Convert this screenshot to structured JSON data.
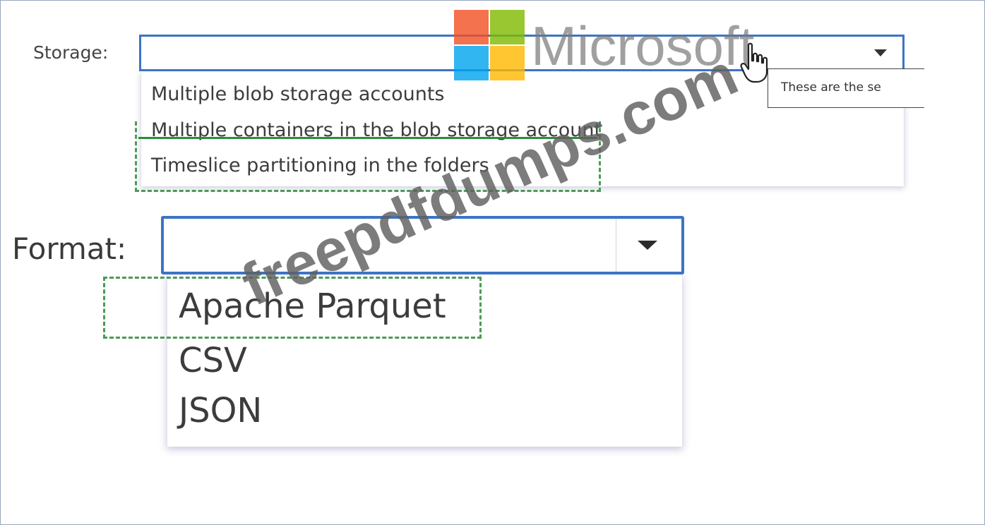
{
  "storage": {
    "label": "Storage:",
    "selected_value": "",
    "options": [
      "Multiple blob storage accounts",
      "Multiple containers in the blob storage account",
      "Timeslice partitioning in the folders"
    ],
    "tooltip": "These are the se"
  },
  "format": {
    "label": "Format:",
    "selected_value": "",
    "options": [
      "Apache Parquet",
      "CSV",
      "JSON"
    ]
  },
  "watermarks": {
    "brand": "Microsoft",
    "site": "freepdfdumps.com"
  },
  "icons": {
    "dropdown": "chevron-down-icon",
    "cursor": "hand-pointer-icon",
    "logo": "microsoft-logo-icon"
  },
  "colors": {
    "select_border": "#3b74c6",
    "annotation": "#4c9a55",
    "logo_red": "#f25022",
    "logo_green": "#7fba00",
    "logo_blue": "#00a4ef",
    "logo_yellow": "#ffb900"
  }
}
